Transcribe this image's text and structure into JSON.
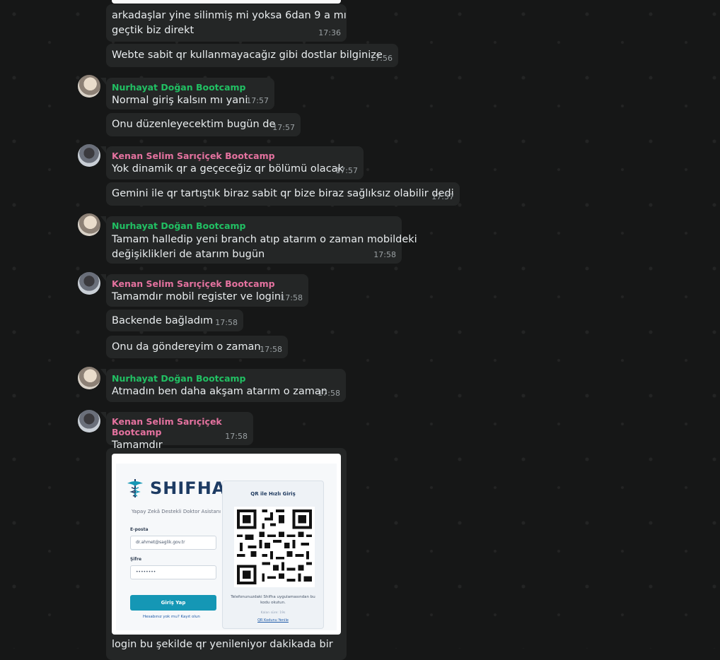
{
  "senders": {
    "nurhayat": "Nurhayat Doğan Bootcamp",
    "kenan": "Kenan Selim Sarıçiçek Bootcamp"
  },
  "colors": {
    "nurhayat": "#21c063",
    "kenan": "#e4729f",
    "bubble": "#242626",
    "background": "#161717"
  },
  "messages": [
    {
      "text1": "arkadaşlar yine silinmiş mi yoksa 6dan 9 a mı",
      "text2": "geçtik biz direkt",
      "time": "17:36"
    },
    {
      "text": "Webte sabit qr kullanmayacağız gibi dostlar bilginize",
      "time": "17:56"
    },
    {
      "text": "Normal giriş kalsın mı yani",
      "time": "17:57"
    },
    {
      "text": "Onu düzenleyecektim bugün de",
      "time": "17:57"
    },
    {
      "text": "Yok dinamik qr a geçeceğiz qr bölümü olacak",
      "time": "17:57"
    },
    {
      "text": "Gemini ile qr tartıştık biraz sabit qr bize biraz sağlıksız olabilir dedi",
      "time": "17:57"
    },
    {
      "text1": "Tamam halledip yeni branch atıp atarım o zaman mobildeki",
      "text2": "değişiklikleri de atarım bugün",
      "time": "17:58"
    },
    {
      "text": "Tamamdır mobil register ve logini",
      "time": "17:58"
    },
    {
      "text": "Backende bağladım",
      "time": "17:58"
    },
    {
      "text": "Onu da göndereyim o zaman",
      "time": "17:58"
    },
    {
      "text": "Atmadın ben daha akşam atarım o zaman",
      "time": "17:58"
    },
    {
      "text": "Tamamdır",
      "time": "17:58"
    },
    {
      "text": "login bu şekilde qr yenileniyor dakikada bir"
    }
  ],
  "image": {
    "logo": "SHIFHA",
    "subtitle": "Yapay Zekâ Destekli Doktor Asistanı",
    "email_label": "E-posta",
    "email_value": "dr.ahmet@saglik.gov.tr",
    "password_label": "Şifre",
    "password_value": "••••••••",
    "login_button": "Giriş Yap",
    "register_link": "Hesabınız yok mu? Kayıt olun",
    "qr_title": "QR ile Hızlı Giriş",
    "qr_caption": "Telefonunuzdaki Shifha uygulamasından bu kodu okutun.",
    "qr_remaining": "Kalan süre: 19s",
    "qr_refresh": "QR Kodunu Yenile"
  }
}
